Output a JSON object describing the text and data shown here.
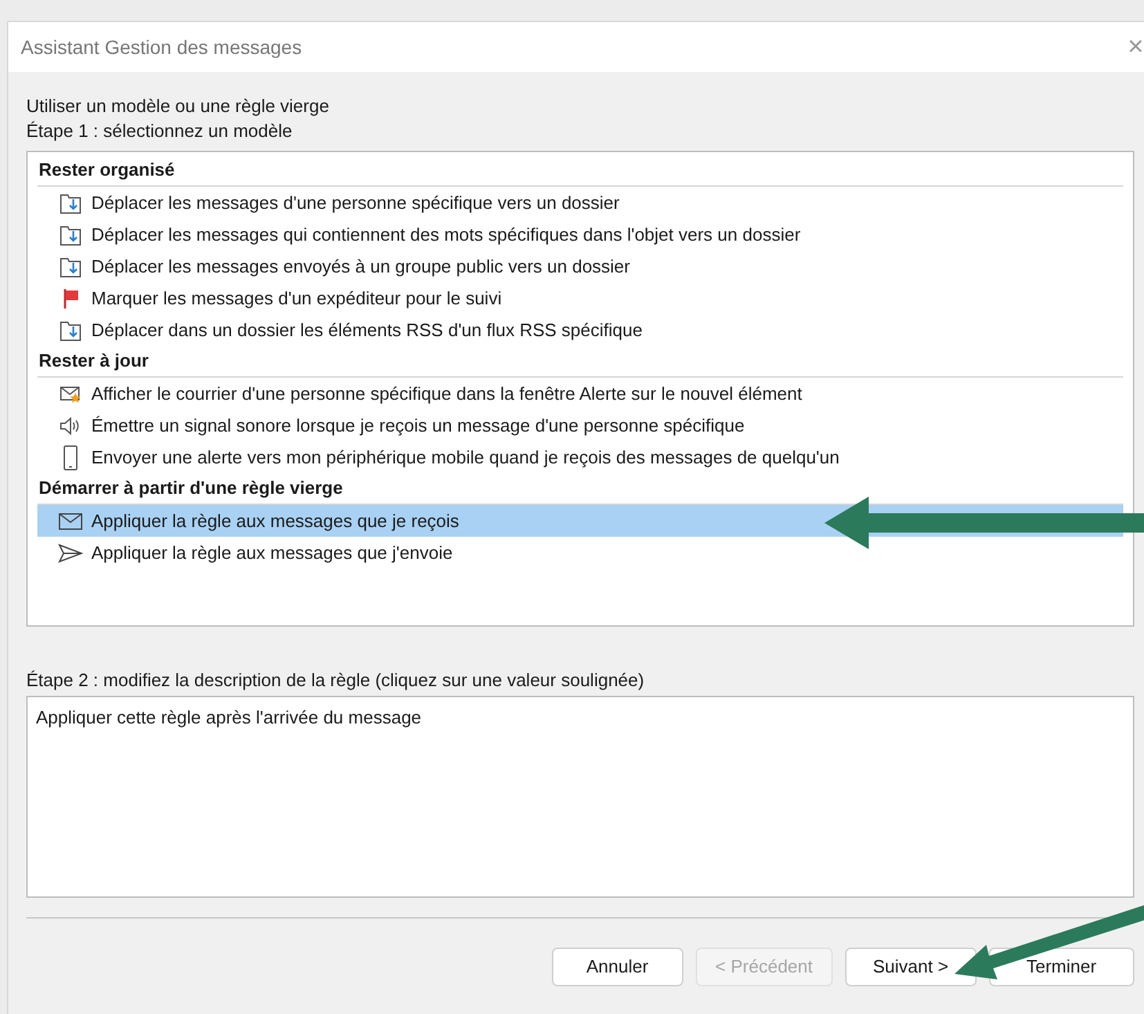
{
  "window": {
    "title": "Assistant Gestion des messages",
    "close": "×"
  },
  "intro": "Utiliser un modèle ou une règle vierge",
  "step1_label": "Étape 1 : sélectionnez un modèle",
  "groups": [
    {
      "title": "Rester organisé",
      "items": [
        {
          "kind": "move",
          "label": "Déplacer les messages d'une personne spécifique vers un dossier",
          "selected": false
        },
        {
          "kind": "move",
          "label": "Déplacer les messages qui contiennent des mots spécifiques dans l'objet vers un dossier",
          "selected": false
        },
        {
          "kind": "move",
          "label": "Déplacer les messages envoyés à un groupe public vers un dossier",
          "selected": false
        },
        {
          "kind": "flag",
          "label": "Marquer les messages d'un expéditeur pour le suivi",
          "selected": false
        },
        {
          "kind": "move",
          "label": "Déplacer dans un dossier les éléments RSS d'un flux RSS spécifique",
          "selected": false
        }
      ]
    },
    {
      "title": "Rester à jour",
      "items": [
        {
          "kind": "alert",
          "label": "Afficher le courrier d'une personne spécifique dans la fenêtre Alerte sur le nouvel élément",
          "selected": false
        },
        {
          "kind": "sound",
          "label": "Émettre un signal sonore lorsque je reçois un message d'une personne spécifique",
          "selected": false
        },
        {
          "kind": "phone",
          "label": "Envoyer une alerte vers mon périphérique mobile quand je reçois des messages de quelqu'un",
          "selected": false
        }
      ]
    },
    {
      "title": "Démarrer à partir d'une règle vierge",
      "items": [
        {
          "kind": "mail",
          "label": "Appliquer la règle aux messages que je reçois",
          "selected": true
        },
        {
          "kind": "send",
          "label": "Appliquer la règle aux messages que j'envoie",
          "selected": false
        }
      ]
    }
  ],
  "step2_label": "Étape 2 : modifiez la description de la règle (cliquez sur une valeur soulignée)",
  "description": "Appliquer cette règle après l'arrivée du message",
  "buttons": [
    {
      "label": "Annuler",
      "disabled": false
    },
    {
      "label": "< Précédent",
      "disabled": true
    },
    {
      "label": "Suivant >",
      "disabled": false
    },
    {
      "label": "Terminer",
      "disabled": false
    }
  ]
}
